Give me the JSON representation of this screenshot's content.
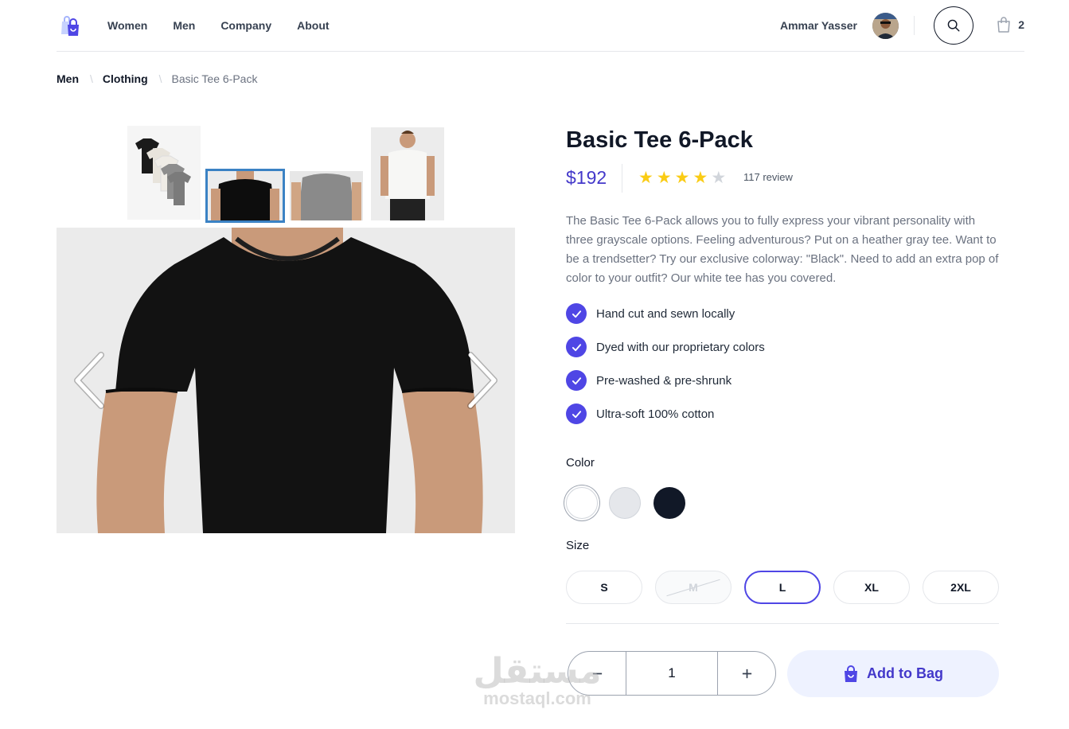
{
  "header": {
    "nav": [
      "Women",
      "Men",
      "Company",
      "About"
    ],
    "user_name": "Ammar Yasser",
    "cart_count": "2"
  },
  "breadcrumb": {
    "items": [
      "Men",
      "Clothing"
    ],
    "current": "Basic Tee 6-Pack"
  },
  "product": {
    "title": "Basic Tee 6-Pack",
    "price": "$192",
    "rating": 4,
    "rating_max": 5,
    "review_text": "117 review",
    "description": "The Basic Tee 6-Pack allows you to fully express your vibrant personality with three grayscale options. Feeling adventurous? Put on a heather gray tee. Want to be a trendsetter? Try our exclusive colorway: \"Black\". Need to add an extra pop of color to your outfit? Our white tee has you covered.",
    "features": [
      "Hand cut and sewn locally",
      "Dyed with our proprietary colors",
      "Pre-washed & pre-shrunk",
      "Ultra-soft 100% cotton"
    ],
    "color_label": "Color",
    "colors": [
      "#ffffff",
      "#e5e7eb",
      "#111827"
    ],
    "size_label": "Size",
    "sizes": [
      "S",
      "M",
      "L",
      "XL",
      "2XL"
    ],
    "quantity": "1",
    "add_to_bag": "Add to Bag"
  },
  "watermark": {
    "arabic": "مستقل",
    "latin": "mostaql.com"
  },
  "colors": {
    "accent": "#4f46e5",
    "price": "#4338ca",
    "star": "#facc15",
    "thumb_selected_border": "#3b82c4"
  }
}
